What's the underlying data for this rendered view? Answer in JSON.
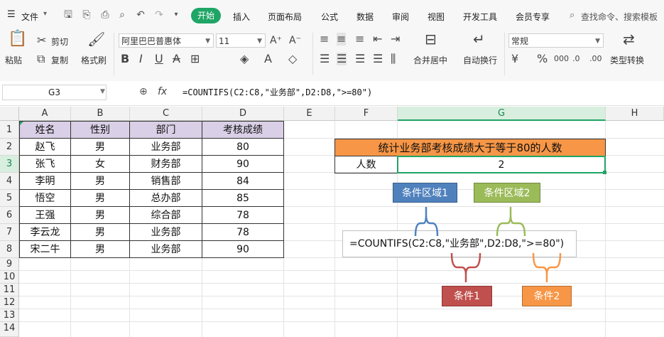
{
  "menubar": {
    "file_label": "文件",
    "tabs": [
      "开始",
      "插入",
      "页面布局",
      "公式",
      "数据",
      "审阅",
      "视图",
      "开发工具",
      "会员专享"
    ],
    "search_label": "查找命令、搜索模板"
  },
  "ribbon": {
    "paste": "粘贴",
    "cut": "剪切",
    "copy": "复制",
    "format_painter": "格式刷",
    "font_name": "阿里巴巴普惠体",
    "font_size": "11",
    "merge_center": "合并居中",
    "wrap_text": "自动换行",
    "number_format": "常规",
    "type_convert": "类型转换"
  },
  "formula_bar": {
    "name_box": "G3",
    "fx_label": "fx",
    "formula": "=COUNTIFS(C2:C8,\"业务部\",D2:D8,\">=80\")"
  },
  "columns": [
    "A",
    "B",
    "C",
    "D",
    "E",
    "F",
    "G",
    "H"
  ],
  "rows": [
    "1",
    "2",
    "3",
    "4",
    "5",
    "6",
    "7",
    "8",
    "9",
    "10",
    "11",
    "12",
    "13",
    "14"
  ],
  "table": {
    "headers": [
      "姓名",
      "性别",
      "部门",
      "考核成绩"
    ],
    "rows": [
      [
        "赵飞",
        "男",
        "业务部",
        "80"
      ],
      [
        "张飞",
        "女",
        "财务部",
        "90"
      ],
      [
        "李明",
        "男",
        "销售部",
        "84"
      ],
      [
        "悟空",
        "男",
        "总办部",
        "85"
      ],
      [
        "王强",
        "男",
        "综合部",
        "78"
      ],
      [
        "李云龙",
        "男",
        "业务部",
        "78"
      ],
      [
        "宋二牛",
        "男",
        "业务部",
        "90"
      ]
    ]
  },
  "summary": {
    "title": "统计业务部考核成绩大于等于80的人数",
    "label": "人数",
    "value": "2"
  },
  "annotation": {
    "range1": "条件区域1",
    "range2": "条件区域2",
    "formula": "=COUNTIFS(C2:C8,\"业务部\",D2:D8,\">=80\")",
    "cond1": "条件1",
    "cond2": "条件2"
  },
  "colors": {
    "accent_green": "#1fa566",
    "header_fill": "#d9cfe6",
    "title_fill": "#f79646",
    "range1": "#4f81bd",
    "range2": "#9bbb59",
    "cond1": "#c0504d",
    "cond2": "#f79646"
  }
}
